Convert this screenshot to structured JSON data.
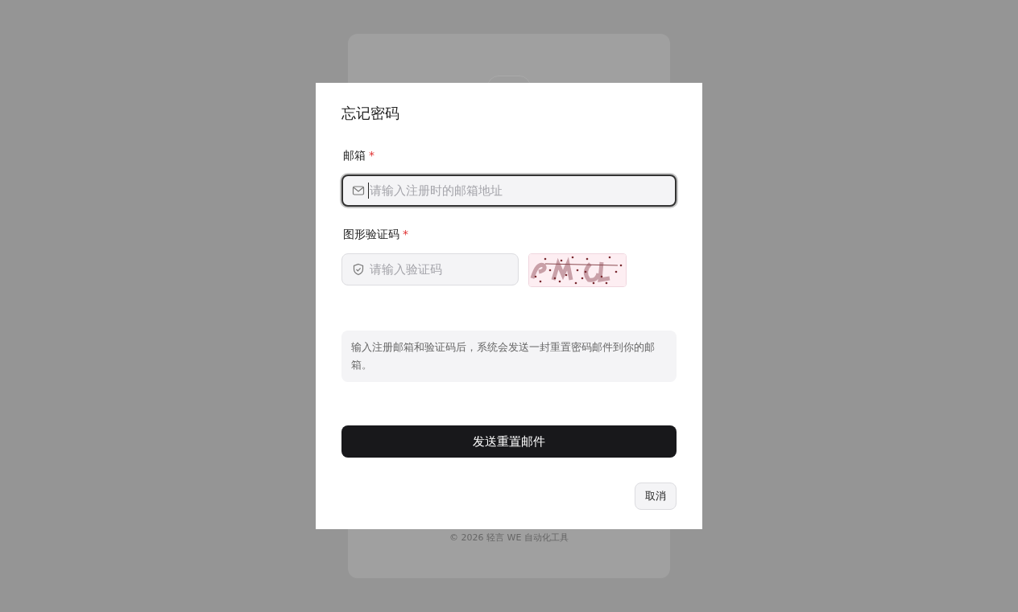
{
  "background": {
    "footer": "© 2026 轻言 WE 自动化工具"
  },
  "dialog": {
    "title": "忘记密码",
    "fields": [
      {
        "label": "邮箱",
        "required_mark": "*",
        "kind": "mail",
        "placeholder": "请输入注册时的邮箱地址",
        "focused": true
      },
      {
        "label": "图形验证码",
        "required_mark": "*",
        "kind": "captcha",
        "placeholder": "请输入验证码",
        "focused": false
      }
    ],
    "hint": "输入注册邮箱和验证码后，系统会发送一封重置密码邮件到你的邮箱。",
    "submit": "发送重置邮件",
    "cancel": "取消"
  }
}
